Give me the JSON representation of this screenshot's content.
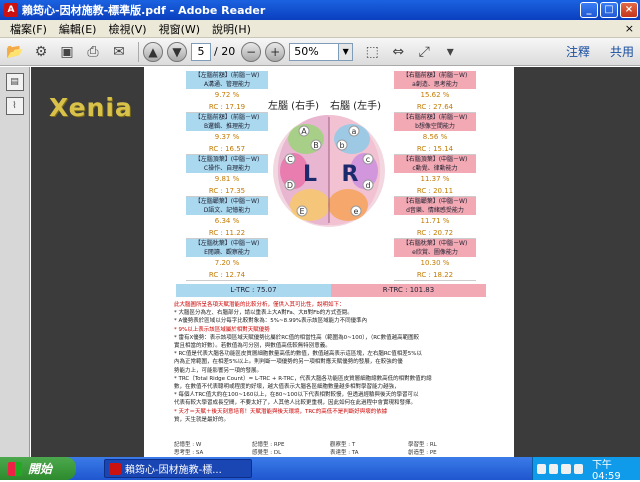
{
  "window": {
    "title": "賴筠心-因材施教-標準版.pdf - Adobe Reader",
    "controls": [
      "_",
      "□",
      "×"
    ]
  },
  "menu": {
    "items": [
      "檔案(F)",
      "編輯(E)",
      "檢視(V)",
      "視窗(W)",
      "說明(H)"
    ],
    "close": "×"
  },
  "toolbar": {
    "page_current": "5",
    "page_total": "/ 20",
    "zoom": "50%",
    "right_links": [
      "注釋",
      "共用"
    ]
  },
  "watermark": "Xenia",
  "document": {
    "left_title": "左腦 (右手)",
    "right_title": "右腦 (左手)",
    "left_boxes": [
      {
        "header": "【左腦前額】(前腦－W)",
        "sub": "A溝通、管理能力",
        "pct": "9.72 %",
        "rc": "RC : 17.19"
      },
      {
        "header": "【左腦前額】(前腦－W)",
        "sub": "B邏輯、推理能力",
        "pct": "9.37 %",
        "rc": "RC : 16.57"
      },
      {
        "header": "【左腦頂葉】(中腦－W)",
        "sub": "C操作、自理能力",
        "pct": "9.81 %",
        "rc": "RC : 17.35"
      },
      {
        "header": "【左腦顳葉】(中腦－W)",
        "sub": "D語文、記憶能力",
        "pct": "6.34 %",
        "rc": "RC : 11.22"
      },
      {
        "header": "【左腦枕葉】(中腦－W)",
        "sub": "E閱讀、觀察能力",
        "pct": "7.20 %",
        "rc": "RC : 12.74"
      }
    ],
    "right_boxes": [
      {
        "header": "【右腦前額】(前腦－W)",
        "sub": "a創造、思考能力",
        "pct": "15.62 %",
        "rc": "RC : 27.64"
      },
      {
        "header": "【右腦前額】(前腦－W)",
        "sub": "b想像空間能力",
        "pct": "8.56 %",
        "rc": "RC : 15.14"
      },
      {
        "header": "【右腦頂葉】(中腦－W)",
        "sub": "c動覺、律動能力",
        "pct": "11.37 %",
        "rc": "RC : 20.11"
      },
      {
        "header": "【右腦顳葉】(中腦－W)",
        "sub": "d音樂、情緒感受能力",
        "pct": "11.71 %",
        "rc": "RC : 20.72"
      },
      {
        "header": "【右腦枕葉】(中腦－W)",
        "sub": "e欣賞、圖像能力",
        "pct": "10.30 %",
        "rc": "RC : 18.22"
      }
    ],
    "left_total": "L-TRC : 75.07",
    "right_total": "R-TRC : 101.83",
    "brain_letters": {
      "L": "L",
      "R": "R"
    },
    "text_lines": [
      "此大腦圖所呈各項天賦潛能的比較分析，僅供入其可比性，說明如下：",
      "* 大腦區分為左、右腦部分，請以重表上大A對Fa、大B對Fb的方式查閱。",
      "* A優勢表於區域以分每字比較對象為：5%~8.99%表示該區域能力不同優準內",
      "* 9%以上表示該區域屬於相對天賦優勢",
      "* 雷有X優勢：表示該項區域天賦優勢比屬於RC值的相當性高（範圍為0~100），（RC數值越高範圍較",
      "  實且相當的好數）。若數值為可分別，與數值高低較無特別意義。",
      "* RC值是代表大腦各功能區皮質層細胞數量高低的數值，數值越高表示這區塊，左右腦RC值相差5%以",
      "  內為正常範圍，在相差5%以上。則判斷一項優勢的另一項相對應天賦優勢的發展，在較強的優",
      "  勢能力上，可能影響另一項的發展。",
      "* TRC（Total Ridge Count）= L-TRC + R-TRC，代表大腦各功能區皮質層細胞總數高低的相對數值的總",
      "  數，在數值不代表聰明或程度的好壞，越大值表示大腦各區細胞數量越多相對學習能力越強，",
      "* 每個人TRC值大約在100~160以上，在80~100以下代表相對較慢，但透過經驗與後天的學習可以",
      "  代表有較大學習成長空間，不要太好了，人其他人比較更重視，因此如何在此過程中會實現和發揮。",
      "* 天才＝天賦＋後天刻意培育！天賦潛能與後天環境，TRC的高低不是判斷好與壞的依據",
      "  質，天生就是最好的。"
    ],
    "grid_rows": [
      [
        "記憶型 : W",
        "記憶型 : RPE",
        "觀察型 : T",
        "學習型 : RL"
      ],
      [
        "思考型 : SA",
        "感覺型 : DL",
        "表達型 : TA",
        "創造型 : PE"
      ]
    ]
  },
  "taskbar": {
    "start": "開始",
    "task": "賴筠心-因材施教-標...",
    "clock": "下午 04:59"
  }
}
